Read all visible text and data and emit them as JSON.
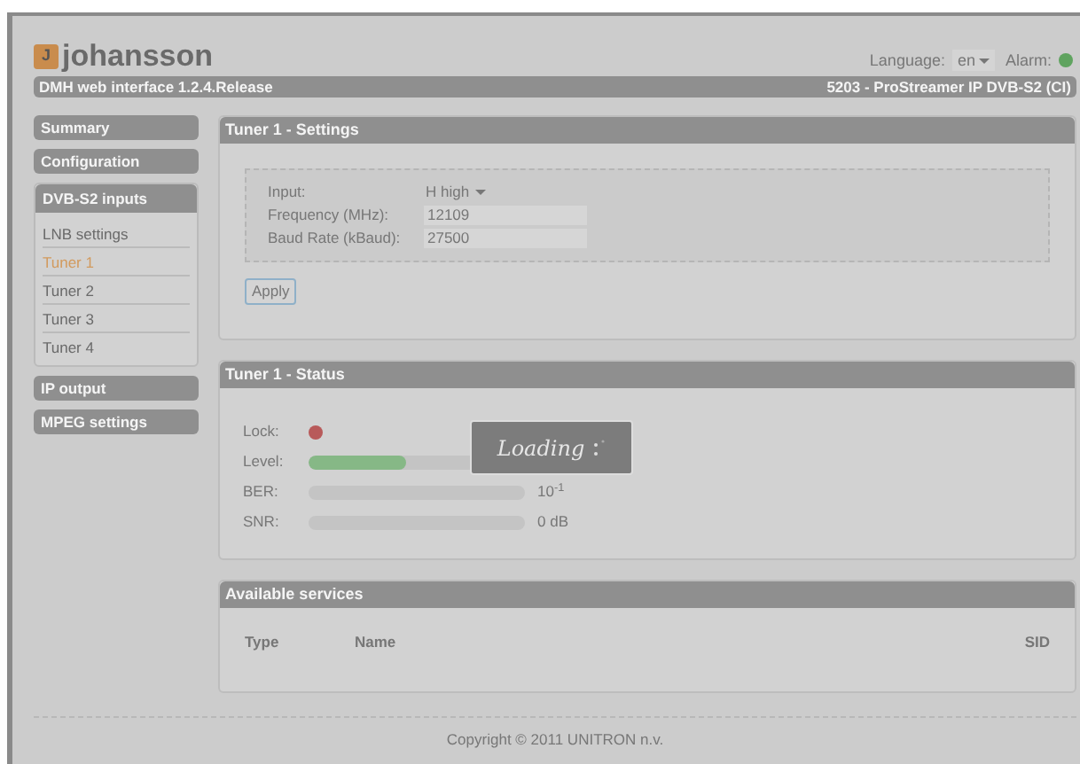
{
  "header": {
    "logo_mark": "J",
    "logo_text": "johansson",
    "language_label": "Language:",
    "language_value": "en",
    "alarm_label": "Alarm:"
  },
  "info_bar": {
    "left": "DMH web interface 1.2.4.Release",
    "right": "5203 - ProStreamer IP DVB-S2 (CI)"
  },
  "sidebar": [
    {
      "label": "Summary"
    },
    {
      "label": "Configuration"
    },
    {
      "label": "DVB-S2 inputs",
      "children": [
        {
          "label": "LNB settings",
          "selected": false
        },
        {
          "label": "Tuner 1",
          "selected": true
        },
        {
          "label": "Tuner 2",
          "selected": false
        },
        {
          "label": "Tuner 3",
          "selected": false
        },
        {
          "label": "Tuner 4",
          "selected": false
        }
      ]
    },
    {
      "label": "IP output"
    },
    {
      "label": "MPEG settings"
    }
  ],
  "settings": {
    "title": "Tuner 1 - Settings",
    "fields": [
      {
        "kind": "select",
        "label": "Input:",
        "value": "H high"
      },
      {
        "kind": "text",
        "label": "Frequency (MHz):",
        "value": "12109"
      },
      {
        "kind": "text",
        "label": "Baud Rate (kBaud):",
        "value": "27500"
      }
    ],
    "apply": "Apply"
  },
  "status": {
    "title": "Tuner 1 - Status",
    "rows": [
      {
        "kind": "dot",
        "label": "Lock:",
        "color": "#b85a5a"
      },
      {
        "kind": "bar",
        "label": "Level:",
        "level": 0.45
      },
      {
        "kind": "bar",
        "label": "BER:",
        "level": 0,
        "reading": "10$^{-1}$"
      },
      {
        "kind": "bar",
        "label": "SNR:",
        "level": 0,
        "reading": "0 dB"
      }
    ]
  },
  "services": {
    "title": "Available services",
    "columns": [
      "Type",
      "Name",
      "SID"
    ]
  },
  "loading": {
    "text": "Loading"
  },
  "footer": "Copyright © 2011 UNITRON n.v."
}
